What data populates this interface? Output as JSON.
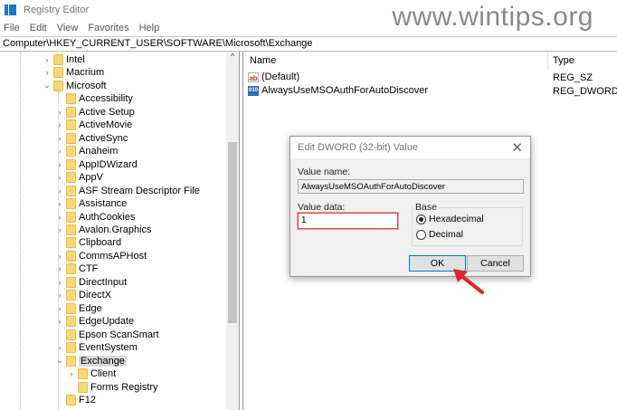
{
  "window": {
    "title": "Registry Editor",
    "watermark": "www.wintips.org"
  },
  "menu": [
    "File",
    "Edit",
    "View",
    "Favorites",
    "Help"
  ],
  "address": "Computer\\HKEY_CURRENT_USER\\SOFTWARE\\Microsoft\\Exchange",
  "tree": [
    {
      "label": "Intel",
      "level": 0,
      "exp": ">"
    },
    {
      "label": "Macrium",
      "level": 0,
      "exp": ">"
    },
    {
      "label": "Microsoft",
      "level": 0,
      "exp": "v"
    },
    {
      "label": "Accessibility",
      "level": 1,
      "exp": ""
    },
    {
      "label": "Active Setup",
      "level": 1,
      "exp": ">"
    },
    {
      "label": "ActiveMovie",
      "level": 1,
      "exp": ">"
    },
    {
      "label": "ActiveSync",
      "level": 1,
      "exp": ">"
    },
    {
      "label": "Anaheim",
      "level": 1,
      "exp": ">"
    },
    {
      "label": "AppIDWizard",
      "level": 1,
      "exp": ">"
    },
    {
      "label": "AppV",
      "level": 1,
      "exp": ">"
    },
    {
      "label": "ASF Stream Descriptor File",
      "level": 1,
      "exp": ">"
    },
    {
      "label": "Assistance",
      "level": 1,
      "exp": ">"
    },
    {
      "label": "AuthCookies",
      "level": 1,
      "exp": ">"
    },
    {
      "label": "Avalon.Graphics",
      "level": 1,
      "exp": ">"
    },
    {
      "label": "Clipboard",
      "level": 1,
      "exp": ""
    },
    {
      "label": "CommsAPHost",
      "level": 1,
      "exp": ">"
    },
    {
      "label": "CTF",
      "level": 1,
      "exp": ">"
    },
    {
      "label": "DirectInput",
      "level": 1,
      "exp": ">"
    },
    {
      "label": "DirectX",
      "level": 1,
      "exp": ">"
    },
    {
      "label": "Edge",
      "level": 1,
      "exp": ">"
    },
    {
      "label": "EdgeUpdate",
      "level": 1,
      "exp": ">"
    },
    {
      "label": "Epson ScanSmart",
      "level": 1,
      "exp": ""
    },
    {
      "label": "EventSystem",
      "level": 1,
      "exp": ">"
    },
    {
      "label": "Exchange",
      "level": 1,
      "exp": "v",
      "selected": true
    },
    {
      "label": "Client",
      "level": 2,
      "exp": ">"
    },
    {
      "label": "Forms Registry",
      "level": 2,
      "exp": ""
    },
    {
      "label": "F12",
      "level": 1,
      "exp": ""
    }
  ],
  "list": {
    "headers": {
      "name": "Name",
      "type": "Type"
    },
    "entries": [
      {
        "name": "(Default)",
        "type": "REG_SZ",
        "icon": "ab"
      },
      {
        "name": "AlwaysUseMSOAuthForAutoDiscover",
        "type": "REG_DWORD",
        "icon": "010"
      }
    ]
  },
  "dialog": {
    "title": "Edit DWORD (32-bit) Value",
    "close": "✕",
    "value_name_label": "Value name:",
    "value_name": "AlwaysUseMSOAuthForAutoDiscover",
    "value_data_label": "Value data:",
    "value_data": "1",
    "base_label": "Base",
    "hex": "Hexadecimal",
    "dec": "Decimal",
    "ok": "OK",
    "cancel": "Cancel"
  },
  "colors": {
    "accent": "#0078d7",
    "arrow": "#e0262b",
    "folder": "#f8d775"
  }
}
